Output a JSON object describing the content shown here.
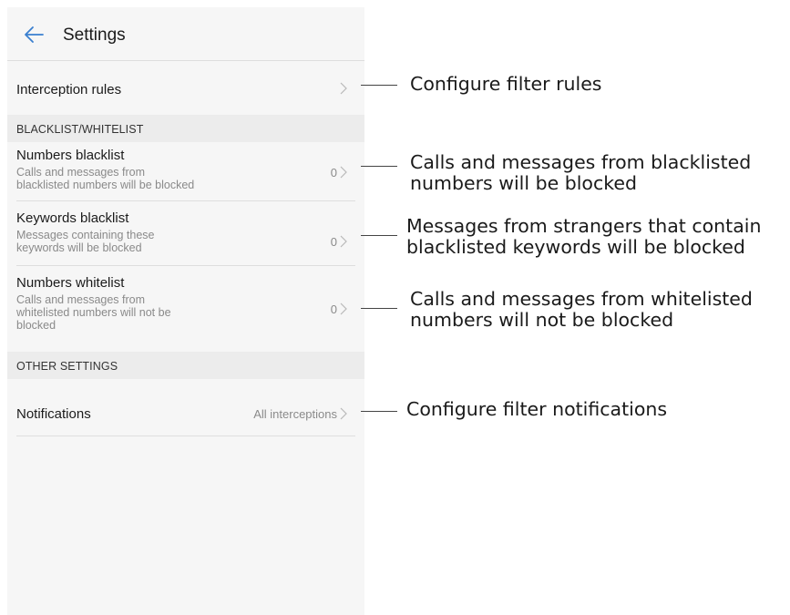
{
  "app": {
    "title": "Settings"
  },
  "interception": {
    "label": "Interception rules"
  },
  "sections": {
    "blacklist_whitelist": "BLACKLIST/WHITELIST",
    "other_settings": "OTHER SETTINGS"
  },
  "lists": [
    {
      "title": "Numbers blacklist",
      "sub_line1": "Calls and messages from",
      "sub_line2": "blacklisted numbers will be blocked",
      "sub_line3": "",
      "count": "0"
    },
    {
      "title": "Keywords blacklist",
      "sub_line1": "Messages containing these",
      "sub_line2": "keywords will be blocked",
      "sub_line3": "",
      "count": "0"
    },
    {
      "title": "Numbers whitelist",
      "sub_line1": "Calls and messages from",
      "sub_line2": "whitelisted numbers will not be",
      "sub_line3": "blocked",
      "count": "0"
    }
  ],
  "notifications": {
    "label": "Notifications",
    "value": "All interceptions"
  },
  "callouts": {
    "interception": "Configure filter rules",
    "numbers_blacklist_1": "Calls and messages from blacklisted",
    "numbers_blacklist_2": "numbers will be blocked",
    "keywords_blacklist_1": "Messages from strangers that contain",
    "keywords_blacklist_2": "blacklisted keywords will be blocked",
    "numbers_whitelist_1": "Calls and messages from whitelisted",
    "numbers_whitelist_2": "numbers will not be blocked",
    "notifications": "Configure filter notifications"
  },
  "colors": {
    "accent": "#3a7fcf",
    "section_bg": "#ececec",
    "screen_bg": "#f6f6f6"
  },
  "icons": {
    "back": "back-arrow-icon",
    "chevron": "chevron-right-icon"
  }
}
